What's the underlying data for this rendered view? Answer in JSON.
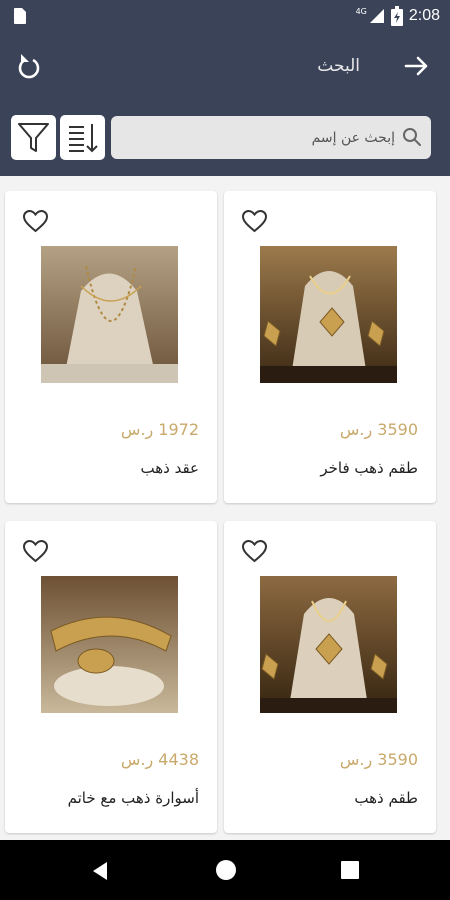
{
  "status_bar": {
    "time": "2:08",
    "network": "4G"
  },
  "header": {
    "title": "البحث"
  },
  "search": {
    "placeholder": "إبحث عن إسم"
  },
  "products": [
    {
      "name": "طقم ذهب فاخر",
      "price": "3590 ر.س"
    },
    {
      "name": "عقد ذهب",
      "price": "1972 ر.س"
    },
    {
      "name": "طقم ذهب",
      "price": "3590 ر.س"
    },
    {
      "name": "أسوارة ذهب مع خاتم",
      "price": "4438 ر.س"
    }
  ],
  "colors": {
    "header_bg": "#3b4359",
    "price": "#c9a96b",
    "page_bg": "#f3f3f3"
  },
  "icons": [
    "back-arrow-icon",
    "refresh-icon",
    "search-icon",
    "sort-icon",
    "filter-icon",
    "heart-icon",
    "nav-back-icon",
    "nav-home-icon",
    "nav-recent-icon"
  ]
}
